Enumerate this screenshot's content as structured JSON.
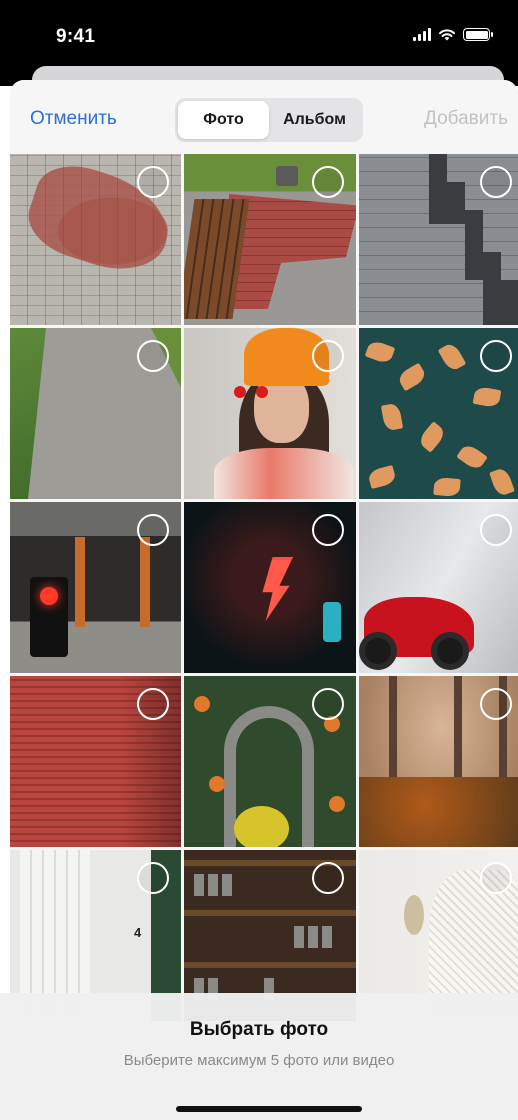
{
  "status_bar": {
    "time": "9:41"
  },
  "nav": {
    "cancel_label": "Отменить",
    "add_label": "Добавить",
    "segments": [
      {
        "label": "Фото",
        "active": true
      },
      {
        "label": "Альбом",
        "active": false
      }
    ]
  },
  "photos": [
    {
      "name": "red-brick-pavement"
    },
    {
      "name": "bench-brick-path"
    },
    {
      "name": "gray-paving-tiles"
    },
    {
      "name": "aerial-courtyard"
    },
    {
      "name": "girl-orange-beanie"
    },
    {
      "name": "autumn-leaves-water"
    },
    {
      "name": "traffic-light-street"
    },
    {
      "name": "neon-lightning"
    },
    {
      "name": "red-motorcycle"
    },
    {
      "name": "red-shutter-wall"
    },
    {
      "name": "aerial-winding-road"
    },
    {
      "name": "autumn-forest"
    },
    {
      "name": "white-curtain-door"
    },
    {
      "name": "wooden-shelves"
    },
    {
      "name": "knitted-chair"
    }
  ],
  "bottom_panel": {
    "title": "Выбрать фото",
    "subtitle": "Выберите максимум 5 фото или видео"
  },
  "colors": {
    "accent": "#2a6fdb",
    "disabled": "#c2c2c6"
  }
}
